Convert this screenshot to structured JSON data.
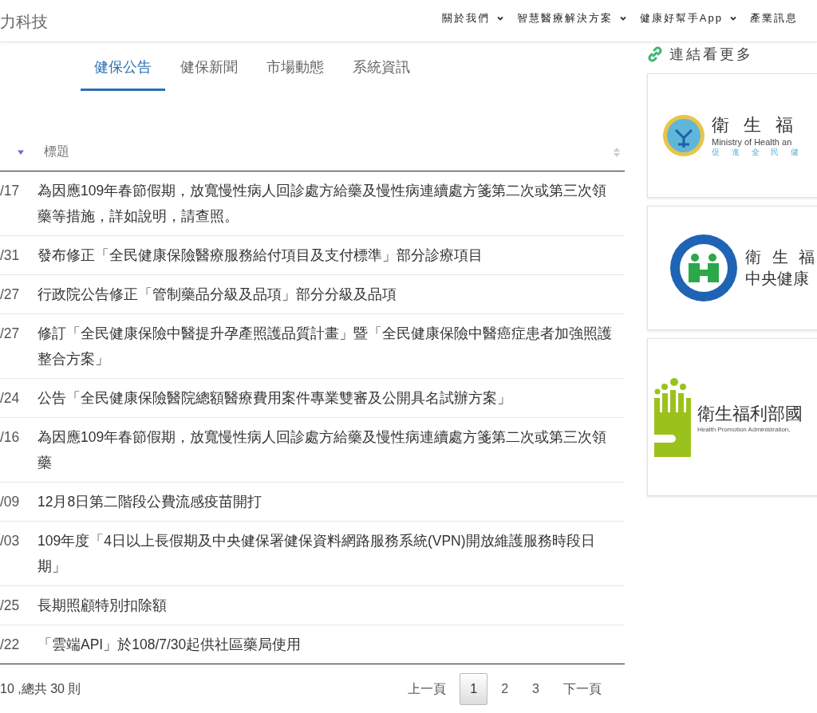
{
  "header": {
    "brand": "力科技",
    "nav": [
      {
        "label": "關於我們",
        "dropdown": true
      },
      {
        "label": "智慧醫療解決方案",
        "dropdown": true
      },
      {
        "label": "健康好幫手App",
        "dropdown": true
      },
      {
        "label": "產業訊息",
        "dropdown": false
      }
    ]
  },
  "tabs": [
    {
      "label": "健保公告",
      "selected": true
    },
    {
      "label": "健保新聞",
      "selected": false
    },
    {
      "label": "市場動態",
      "selected": false
    },
    {
      "label": "系統資訊",
      "selected": false
    }
  ],
  "table": {
    "columns": [
      {
        "sorted": true
      },
      {
        "label": "標題",
        "sorted": false
      }
    ],
    "rows": [
      {
        "date": "/17",
        "title": "為因應109年春節假期，放寬慢性病人回診處方給藥及慢性病連續處方箋第二次或第三次領藥等措施，詳如說明，請查照。"
      },
      {
        "date": "/31",
        "title": "發布修正「全民健康保險醫療服務給付項目及支付標準」部分診療項目"
      },
      {
        "date": "/27",
        "title": "行政院公告修正「管制藥品分級及品項」部分分級及品項"
      },
      {
        "date": "/27",
        "title": "修訂「全民健康保險中醫提升孕產照護品質計畫」暨「全民健康保險中醫癌症患者加強照護整合方案」"
      },
      {
        "date": "/24",
        "title": "公告「全民健康保險醫院總額醫療費用案件專業雙審及公開具名試辦方案」"
      },
      {
        "date": "/16",
        "title": "為因應109年春節假期，放寬慢性病人回診處方給藥及慢性病連續處方箋第二次或第三次領藥"
      },
      {
        "date": "/09",
        "title": "12月8日第二階段公費流感疫苗開打"
      },
      {
        "date": "/03",
        "title": "109年度「4日以上長假期及中央健保署健保資料網路服務系統(VPN)開放維護服務時段日期」"
      },
      {
        "date": "/25",
        "title": "長期照顧特別扣除額"
      },
      {
        "date": "/22",
        "title": "「雲端API」於108/7/30起供社區藥局使用"
      }
    ]
  },
  "footer": {
    "summary": "10 ,總共 30 則",
    "pagination": [
      {
        "label": "上一頁",
        "selected": false
      },
      {
        "label": "1",
        "selected": true
      },
      {
        "label": "2",
        "selected": false
      },
      {
        "label": "3",
        "selected": false
      },
      {
        "label": "下一頁",
        "selected": false
      }
    ]
  },
  "sidebar": {
    "title": "連結看更多",
    "links": [
      {
        "kind": "ministry",
        "lines": [
          "衛 生 福",
          "Ministry of Health an",
          "促 進 全 民 健"
        ]
      },
      {
        "kind": "insurance",
        "lines": [
          "衛 生 福",
          "中央健康"
        ]
      },
      {
        "kind": "promotion",
        "lines": [
          "衛生福利部國",
          "Health Promotion Administration,"
        ]
      }
    ]
  }
}
